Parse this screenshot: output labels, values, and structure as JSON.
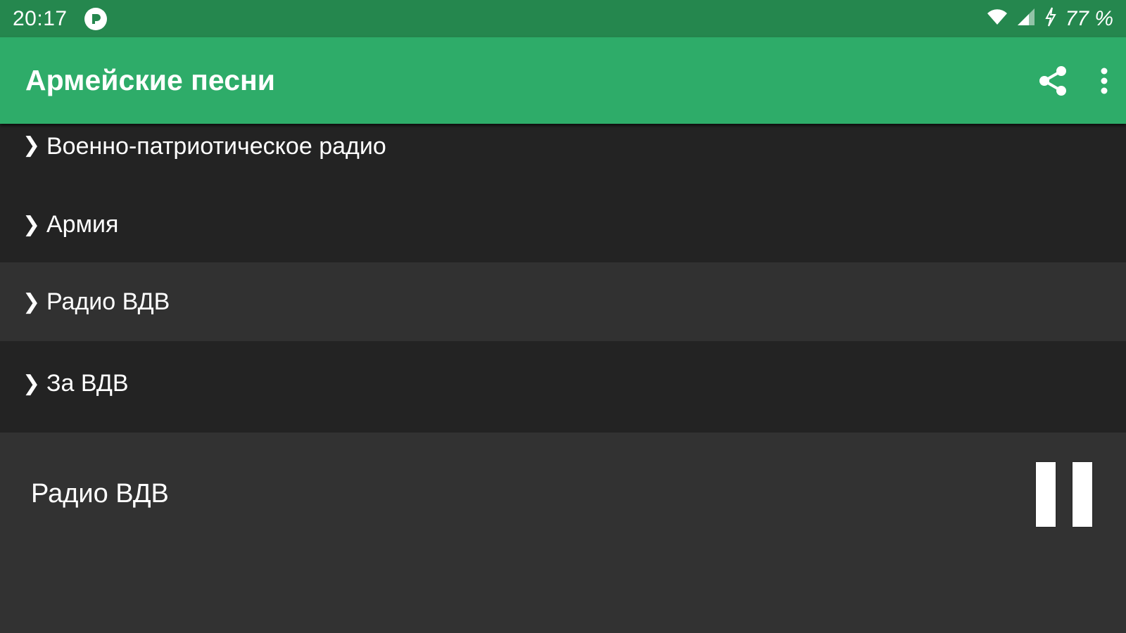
{
  "status_bar": {
    "time": "20:17",
    "battery": "77 %"
  },
  "app_bar": {
    "title": "Армейские песни"
  },
  "stations": [
    {
      "label": "Военно-патриотическое радио",
      "selected": false
    },
    {
      "label": "Армия",
      "selected": false
    },
    {
      "label": "Радио ВДВ",
      "selected": true
    },
    {
      "label": "За ВДВ",
      "selected": false
    }
  ],
  "player": {
    "now_playing": "Радио ВДВ",
    "state": "playing"
  },
  "icons": {
    "chevron": "chevron-right-icon",
    "share": "share-icon",
    "overflow": "more-vert-icon",
    "pause": "pause-icon"
  },
  "colors": {
    "status_bar": "#25874e",
    "app_bar": "#2eac69",
    "list_background": "#232323",
    "selected_row": "#313131",
    "player_background": "#323232"
  }
}
